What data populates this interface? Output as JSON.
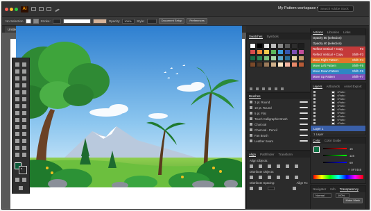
{
  "menubar": {
    "app_badge": "Ai",
    "workspace": "My Pattern workspace ▾",
    "search_placeholder": "Search Adobe Stock"
  },
  "control_bar": {
    "selection_label": "No Selection",
    "stroke_label": "Stroke:",
    "opacity_label": "Opacity:",
    "opacity_value": "100%",
    "style_label": "Style:",
    "document_setup": "Document Setup",
    "preferences": "Preferences"
  },
  "document_tab": {
    "title": "Untitled-4.ai* @ 66.67% (RGB/CPU Preview)"
  },
  "swatches_panel": {
    "tabs": [
      "Swatches",
      "Symbols"
    ],
    "colors": [
      [
        "#ffffff",
        "#000000",
        "#e6e6e6",
        "#bdbdbd",
        "#8a8a8a",
        "#5a5a5a",
        "#2d2d2d",
        "#1e1e1e"
      ],
      [
        "#d94c4c",
        "#f08a36",
        "#f2c94c",
        "#5bb85b",
        "#3a9ad9",
        "#3558b0",
        "#7c4fb3",
        "#c24f9a"
      ],
      [
        "#1a6b45",
        "#2e8b57",
        "#7bc47f",
        "#a8d8a8",
        "#5aa6c8",
        "#2a6f9a",
        "#e7d6a8",
        "#c49a6c"
      ],
      [
        "#7a4a2a",
        "#4f3a2a",
        "#9b7b5b",
        "#cfb08a",
        "#fde4c2",
        "#f7b7a3",
        "#e88a6a",
        "#b85c38"
      ]
    ]
  },
  "brushes_panel": {
    "title": "Brushes",
    "items": [
      "3 pt. Round",
      "10 pt. Round",
      "5 pt. Flat",
      "Touch Calligraphic Brush",
      "Charcoal",
      "Charcoal - Pencil",
      "Fan Brush",
      "Leather Seam"
    ]
  },
  "align_panel": {
    "tabs": [
      "Align",
      "Pathfinder",
      "Transform"
    ],
    "align_objects": "Align Objects:",
    "distribute_objects": "Distribute Objects:",
    "distribute_spacing": "Distribute Spacing:",
    "align_to": "Align To:"
  },
  "actions_panel": {
    "tabs": [
      "Actions",
      "Libraries",
      "Links"
    ],
    "items": [
      {
        "label": "Opacity 60 (selection)",
        "key": "",
        "color": "#3a3a3a"
      },
      {
        "label": "Opacity 40 (selection)",
        "key": "",
        "color": "#3a3a3a"
      },
      {
        "label": "Reflect Vertical + Copy",
        "key": "F3",
        "color": "#c43a3a"
      },
      {
        "label": "Reflect Vertical + Copy",
        "key": "Shift+F3",
        "color": "#c43a3a"
      },
      {
        "label": "Move Right Pattern",
        "key": "Shift+F4",
        "color": "#e0762a"
      },
      {
        "label": "Move Left Pattern",
        "key": "Shift+F5",
        "color": "#3aa655"
      },
      {
        "label": "Move Down Pattern",
        "key": "Shift+F6",
        "color": "#2f86c4"
      },
      {
        "label": "Move Up Pattern",
        "key": "Shift+F7",
        "color": "#7d4fb5"
      }
    ]
  },
  "layers_panel": {
    "tabs": [
      "Layers",
      "Artboards",
      "Asset Export"
    ],
    "items": [
      "<Path>",
      "<Path>",
      "<Path>",
      "<Path>",
      "<Path>",
      "<Path>",
      "<Path>",
      "<Path>",
      "<Path>",
      "<Path>"
    ],
    "layer_name": "Layer 1",
    "footer": "1 Layer"
  },
  "color_panel": {
    "tabs": [
      "Color",
      "Color Guide"
    ],
    "r": "15",
    "g": "116",
    "b": "69",
    "hex": "0F7445"
  },
  "transparency_panel": {
    "tabs": [
      "Navigator",
      "Info",
      "Transparency"
    ],
    "mode": "Normal",
    "opacity": "100%",
    "make_mask": "Make Mask"
  }
}
